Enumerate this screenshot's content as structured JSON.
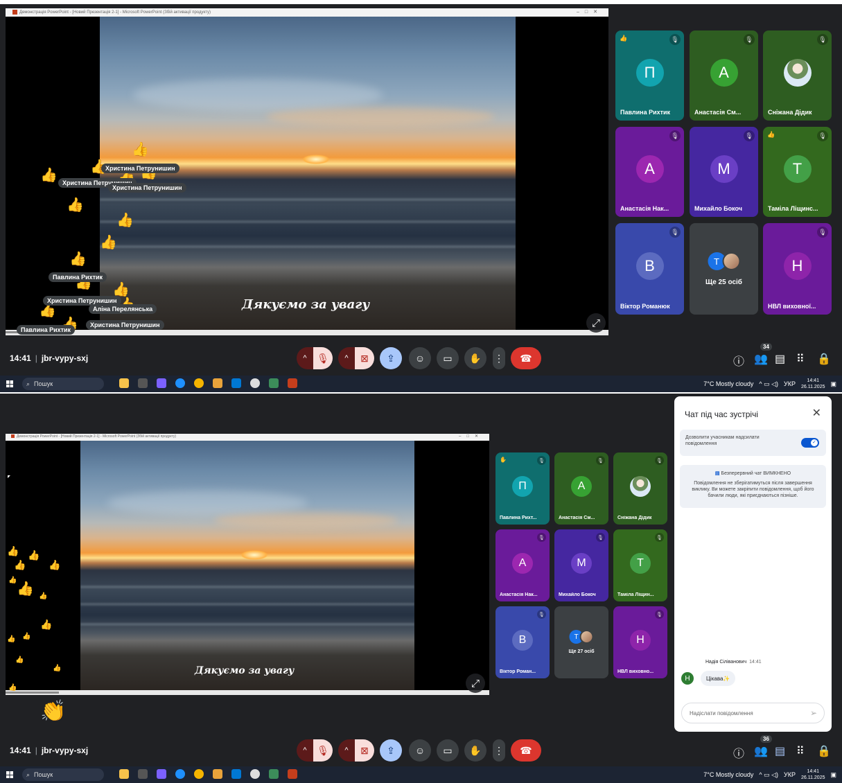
{
  "screen1": {
    "window_title": "Демонстрація PowerPoint - [Новий Презентація 2-1] - Microsoft PowerPoint (Збій активації продукту)",
    "slide_caption": "Дякуємо за увагу",
    "reactions": [
      {
        "label": "Христина Петрунишин"
      },
      {
        "label": "Христина Петрунишин"
      },
      {
        "label": "Христина Петрунишин"
      },
      {
        "label": "Павлина Рихтик"
      },
      {
        "label": "Христина Петрунишин"
      },
      {
        "label": "Аліна Перелянська"
      },
      {
        "label": "Христина Петрунишин"
      },
      {
        "label": "Павлина Рихтик"
      }
    ],
    "tiles": [
      {
        "initial": "П",
        "name": "Павлина Рихтик",
        "color": "#0f6e6e",
        "avatar": "#12a4af",
        "hand": true
      },
      {
        "initial": "А",
        "name": "Анастасія См...",
        "color": "#2e5d21",
        "avatar": "#37a233"
      },
      {
        "initial": "",
        "name": "Сніжана Дідик",
        "color": "#2e5d21",
        "avatar": "photo"
      },
      {
        "initial": "А",
        "name": "Анастасія Нак...",
        "color": "#6a1b9a",
        "avatar": "#9c27b0"
      },
      {
        "initial": "М",
        "name": "Михайло Бокоч",
        "color": "#4527a0",
        "avatar": "#6a3fc5"
      },
      {
        "initial": "Т",
        "name": "Таміла Ліщинс...",
        "color": "#33691e",
        "avatar": "#43a047",
        "hand": true
      },
      {
        "initial": "В",
        "name": "Віктор Романюк",
        "color": "#3949ab",
        "avatar": "#5c6bc0"
      },
      {
        "more": "Ще 25 осіб",
        "initial": "Т",
        "color": "#3c4043"
      },
      {
        "initial": "Н",
        "name": "НВЛ виховної...",
        "color": "#6a1b9a",
        "avatar": "#8e24aa"
      }
    ],
    "time": "14:41",
    "meeting_code": "jbr-vypy-sxj",
    "participants_count": "34"
  },
  "screen2": {
    "window_title": "Демонстрація PowerPoint - [Новий Презентація 2-1] - Microsoft PowerPoint (Збій активації продукту)",
    "slide_caption": "Дякуємо за увагу",
    "tiles": [
      {
        "initial": "П",
        "name": "Павлина Рихт...",
        "color": "#0f6e6e",
        "avatar": "#12a4af",
        "hand": true
      },
      {
        "initial": "А",
        "name": "Анастасія См...",
        "color": "#2e5d21",
        "avatar": "#37a233"
      },
      {
        "initial": "",
        "name": "Сніжана Дідик",
        "color": "#2e5d21",
        "avatar": "photo"
      },
      {
        "initial": "А",
        "name": "Анастасія Нак...",
        "color": "#6a1b9a",
        "avatar": "#9c27b0"
      },
      {
        "initial": "М",
        "name": "Михайло Бокоч",
        "color": "#4527a0",
        "avatar": "#6a3fc5"
      },
      {
        "initial": "Т",
        "name": "Таміла Ліщин...",
        "color": "#33691e",
        "avatar": "#43a047"
      },
      {
        "initial": "В",
        "name": "Віктор Роман...",
        "color": "#3949ab",
        "avatar": "#5c6bc0"
      },
      {
        "more": "Ще 27 осіб",
        "initial": "Т",
        "color": "#3c4043"
      },
      {
        "initial": "Н",
        "name": "НВЛ виховно...",
        "color": "#6a1b9a",
        "avatar": "#8e24aa"
      }
    ],
    "time": "14:41",
    "meeting_code": "jbr-vypy-sxj",
    "participants_count": "36",
    "chat": {
      "title": "Чат під час зустрічі",
      "allow_messages": "Дозволити учасникам надсилати повідомлення",
      "continuous_chat": "Безперервний чат ВИМКНЕНО",
      "info": "Повідомлення не зберігатимуться після завершення виклику. Ви можете закріпити повідомлення, щоб його бачили люди, які приєднаються пізніше.",
      "message_author": "Надія Сіліванович",
      "message_time": "14:41",
      "message_text": "Цікава✨",
      "message_avatar": "Н",
      "input_placeholder": "Надіслати повідомлення"
    }
  },
  "taskbar": {
    "search": "Пошук",
    "weather": "7°C  Mostly cloudy",
    "language": "УКР",
    "time": "14:41",
    "date": "26.11.2025"
  }
}
